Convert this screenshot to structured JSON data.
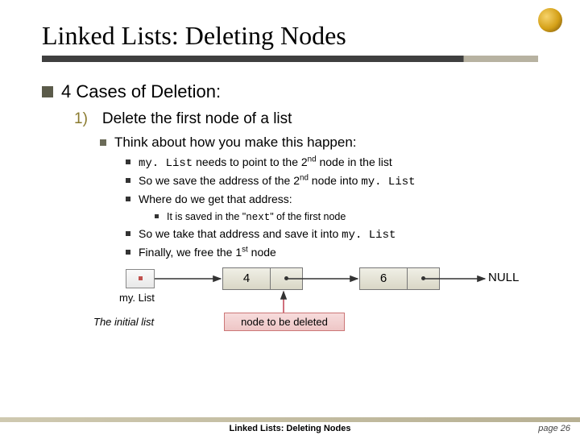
{
  "title": "Linked Lists:  Deleting Nodes",
  "bullets": {
    "l1": "4 Cases of Deletion:",
    "num": "1)",
    "l2": "Delete the first node of a list",
    "l3": "Think about how you make this happen:",
    "d1_pre": "my. List",
    "d1_mid": " needs to point to the 2",
    "d1_sup": "nd",
    "d1_post": " node in the list",
    "d2_pre": "So we save the address of the 2",
    "d2_sup": "nd",
    "d2_mid": " node into ",
    "d2_code": "my. List",
    "d3": "Where do we get that address:",
    "d3a_pre": "It is saved in the \"",
    "d3a_code": "next",
    "d3a_post": "\" of the first node",
    "d4_pre": "So we take that address and save it into ",
    "d4_code": "my. List",
    "d5_pre": "Finally, we free the 1",
    "d5_sup": "st",
    "d5_post": " node"
  },
  "diagram": {
    "mylist_label": "my. List",
    "node1_value": "4",
    "node2_value": "6",
    "null_label": "NULL",
    "initial_caption": "The initial list",
    "delete_label": "node to be deleted"
  },
  "footer": {
    "title": "Linked Lists: Deleting Nodes",
    "page": "page 26"
  }
}
